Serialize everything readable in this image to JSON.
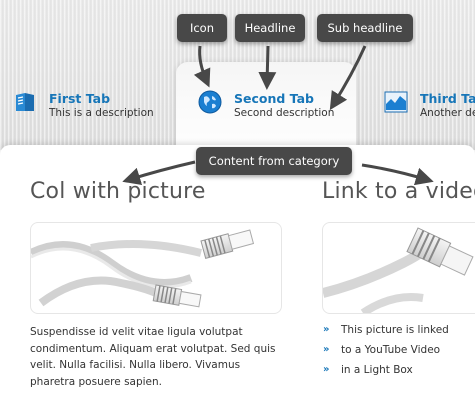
{
  "tabs": [
    {
      "title": "First Tab",
      "description": "This is a description",
      "icon": "book-icon"
    },
    {
      "title": "Second Tab",
      "description": "Second description",
      "icon": "globe-icon"
    },
    {
      "title": "Third Tab",
      "description": "Another de",
      "icon": "chart-icon"
    }
  ],
  "callouts": {
    "icon": "Icon",
    "headline": "Headline",
    "sub_headline": "Sub headline",
    "content": "Content from category"
  },
  "columns": {
    "left": {
      "title": "Col with picture",
      "text_lines": [
        "Suspendisse id velit vitae ligula volutpat",
        "condimentum. Aliquam erat volutpat. Sed quis",
        "velit. Nulla facilisi. Nulla libero. Vivamus",
        "pharetra posuere sapien."
      ]
    },
    "right": {
      "title": "Link to a video",
      "bullets": [
        "This picture is linked",
        "to a YouTube Video",
        "in a Light Box"
      ]
    }
  },
  "colors": {
    "accent": "#1776b8",
    "callout_bg": "#484848"
  }
}
